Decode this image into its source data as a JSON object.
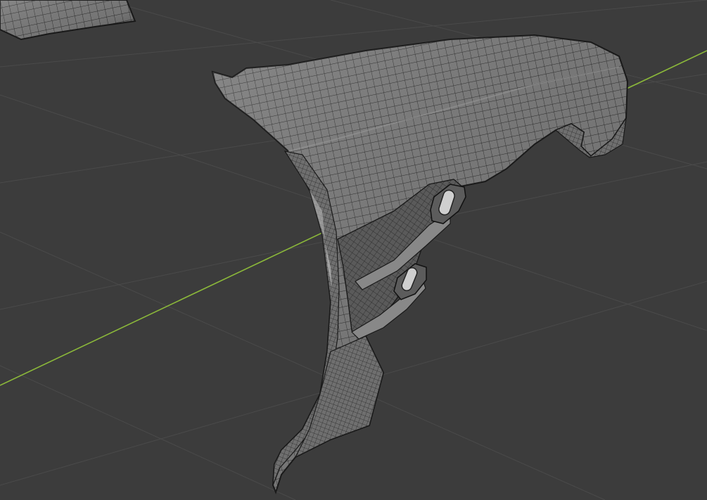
{
  "viewport": {
    "kind": "3d-viewport",
    "shading": "solid-wireframe",
    "background_color": "#3c3c3c",
    "grid_color": "#4c4c4c",
    "x_axis_color": "#8bb83a",
    "mesh_color": "#7d7d7d",
    "wire_color": "#1e1e1e"
  },
  "objects": [
    {
      "name": "fender-mesh",
      "label": ""
    },
    {
      "name": "partial-mesh-top-left",
      "label": ""
    }
  ]
}
